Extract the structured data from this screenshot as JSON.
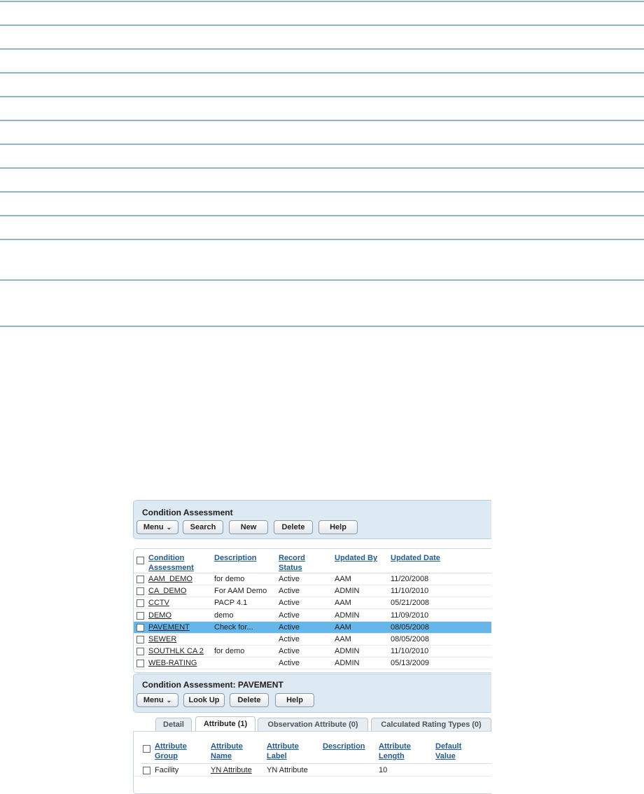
{
  "header_panel": {
    "title": "Condition Assessment",
    "buttons": {
      "menu": "Menu",
      "search": "Search",
      "new": "New",
      "delete": "Delete",
      "help": "Help"
    }
  },
  "list": {
    "columns": [
      {
        "line1": "Condition",
        "line2": "Assessment"
      },
      {
        "line1": "Description",
        "line2": ""
      },
      {
        "line1": "Record",
        "line2": "Status"
      },
      {
        "line1": "Updated By",
        "line2": ""
      },
      {
        "line1": "Updated Date",
        "line2": ""
      }
    ],
    "rows": [
      {
        "name": "AAM_DEMO",
        "description": "for demo",
        "status": "Active",
        "updated_by": "AAM",
        "updated_date": "11/20/2008"
      },
      {
        "name": "CA_DEMO",
        "description": "For AAM Demo",
        "status": "Active",
        "updated_by": "ADMIN",
        "updated_date": "11/10/2010"
      },
      {
        "name": "CCTV",
        "description": "PACP 4.1",
        "status": "Active",
        "updated_by": "AAM",
        "updated_date": "05/21/2008"
      },
      {
        "name": "DEMO",
        "description": "demo",
        "status": "Active",
        "updated_by": "ADMIN",
        "updated_date": "11/09/2010"
      },
      {
        "name": "PAVEMENT",
        "description": "Check for...",
        "status": "Active",
        "updated_by": "AAM",
        "updated_date": "08/05/2008",
        "selected": true
      },
      {
        "name": "SEWER",
        "description": "",
        "status": "Active",
        "updated_by": "AAM",
        "updated_date": "08/05/2008"
      },
      {
        "name": "SOUTHLK CA 2",
        "description": "for demo",
        "status": "Active",
        "updated_by": "ADMIN",
        "updated_date": "11/10/2010"
      },
      {
        "name": "WEB-RATING",
        "description": "",
        "status": "Active",
        "updated_by": "ADMIN",
        "updated_date": "05/13/2009"
      }
    ]
  },
  "detail_panel": {
    "title": "Condition Assessment: PAVEMENT",
    "buttons": {
      "menu": "Menu",
      "lookup": "Look Up",
      "delete": "Delete",
      "help": "Help"
    }
  },
  "tabs": [
    {
      "label": "Detail",
      "active": false
    },
    {
      "label": "Attribute (1)",
      "active": true
    },
    {
      "label": "Observation Attribute (0)",
      "active": false
    },
    {
      "label": "Calculated Rating Types (0)",
      "active": false
    }
  ],
  "attributes": {
    "columns": [
      {
        "line1": "Attribute",
        "line2": "Group"
      },
      {
        "line1": "Attribute",
        "line2": "Name"
      },
      {
        "line1": "Attribute",
        "line2": "Label"
      },
      {
        "line1": "Description",
        "line2": ""
      },
      {
        "line1": "Attribute",
        "line2": "Length"
      },
      {
        "line1": "Default",
        "line2": "Value"
      }
    ],
    "rows": [
      {
        "group": "Facility",
        "name": "YN Attribute",
        "label": "YN Attribute",
        "description": "",
        "length": "10",
        "default": ""
      }
    ]
  },
  "colors": {
    "rule": "#8fb8c6",
    "panel": "#dde9f3",
    "selected_row": "#66b6ea",
    "link": "#1f5a98"
  },
  "icons": {
    "menu_dropdown": "double-chevron-down-icon",
    "checkbox": "checkbox-icon"
  }
}
